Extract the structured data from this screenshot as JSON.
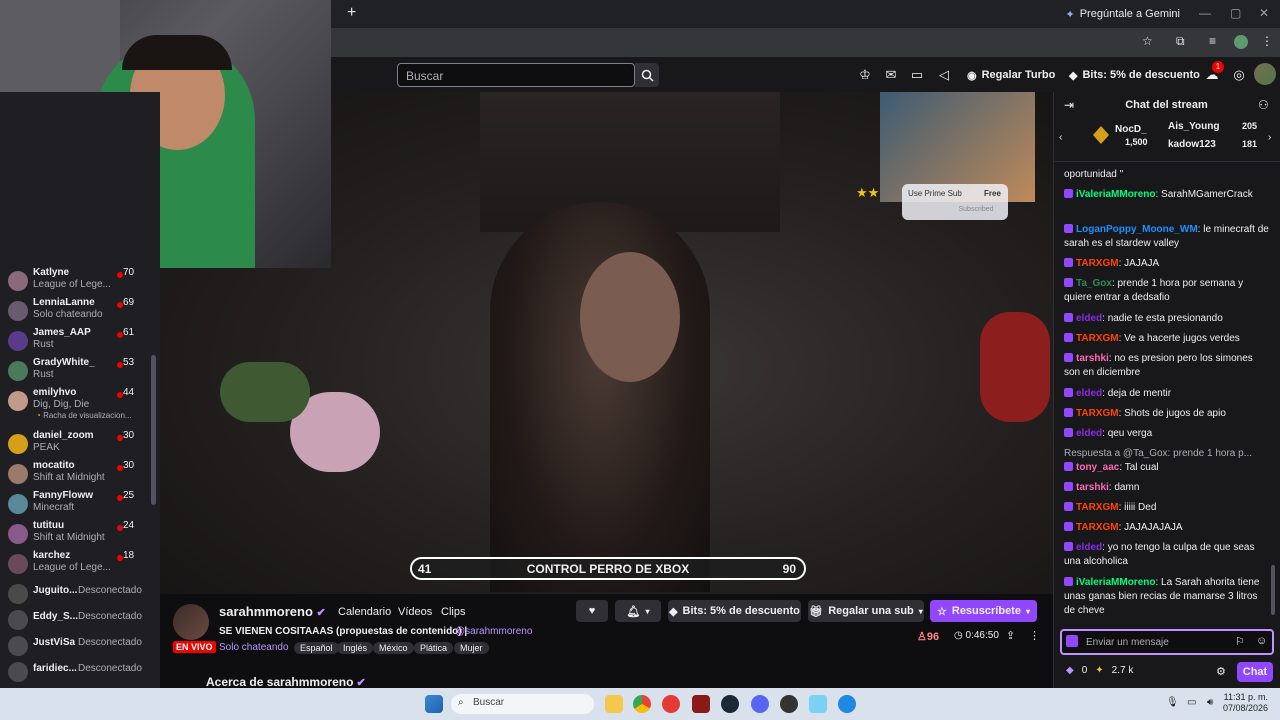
{
  "browser": {
    "gemini_label": "Pregúntale a Gemini",
    "new_tab": "+"
  },
  "topnav": {
    "search_placeholder": "Buscar",
    "turbo_label": "Regalar Turbo",
    "bits_label": "Bits: 5% de descuento",
    "notification_count": "1"
  },
  "sidebar": {
    "live": [
      {
        "name": "Katlyne",
        "game": "League of Lege...",
        "viewers": "70"
      },
      {
        "name": "LenniaLanne",
        "game": "Solo chateando",
        "viewers": "69"
      },
      {
        "name": "James_AAP",
        "game": "Rust",
        "viewers": "61"
      },
      {
        "name": "GradyWhite_",
        "game": "Rust",
        "viewers": "53"
      },
      {
        "name": "emilyhvo",
        "game": "Dig, Dig, Die",
        "viewers": "44",
        "extra": "Racha de visualizacion..."
      },
      {
        "name": "daniel_zoom",
        "game": "PEAK",
        "viewers": "30"
      },
      {
        "name": "mocatito",
        "game": "Shift at Midnight",
        "viewers": "30"
      },
      {
        "name": "FannyFloww",
        "game": "Minecraft",
        "viewers": "25"
      },
      {
        "name": "tutituu",
        "game": "Shift at Midnight",
        "viewers": "24"
      },
      {
        "name": "karchez",
        "game": "League of Lege...",
        "viewers": "18"
      }
    ],
    "offline": [
      {
        "name": "Juguito...",
        "status": "Desconectado"
      },
      {
        "name": "Eddy_S...",
        "status": "Desconectado"
      },
      {
        "name": "JustViSa",
        "status": "Desconectado"
      },
      {
        "name": "faridiec...",
        "status": "Desconectado"
      }
    ]
  },
  "video": {
    "goal_start": "41",
    "goal_label": "CONTROL PERRO DE XBOX",
    "goal_end": "90",
    "goal_progress": 0.0,
    "prime_text": "Use Prime Sub",
    "prime_free": "Free",
    "prime_btn": "Subscribed"
  },
  "info": {
    "streamer": "sarahmmoreno",
    "live_badge": "EN VIVO",
    "link_calendar": "Calendario",
    "link_videos": "Vídeos",
    "link_clips": "Clips",
    "title": "SE VIENEN COSITAAAS (propuestas de contenido) |",
    "handle": "@sarahmmoreno",
    "category": "Solo chateando",
    "tags": [
      "Español",
      "Inglés",
      "México",
      "Plática",
      "Mujer"
    ],
    "bits_btn": "Bits: 5% de descuento",
    "gift_btn": "Regalar una sub",
    "resub_btn": "Resuscríbete",
    "viewers": "96",
    "uptime": "0:46:50",
    "about": "Acerca de sarahmmoreno"
  },
  "chat": {
    "header": "Chat del stream",
    "hype": [
      {
        "name": "NocD_",
        "amount": "1,500"
      },
      {
        "name": "Ais_Young",
        "amount": "205"
      },
      {
        "name": "kadow123",
        "amount": "181"
      }
    ],
    "messages": [
      {
        "user": "",
        "text": "oportunidad \"",
        "color": "#efeff1"
      },
      {
        "user": "iValeriaMMoreno",
        "text": "SarahMGamerCrack",
        "color": "#00ff7f"
      },
      {
        "user": "LoganPoppy_Moone_WM",
        "text": "le minecraft de sarah es el stardew valley",
        "color": "#1e90ff"
      },
      {
        "user": "TARXGM",
        "text": "JAJAJA",
        "color": "#ff4500"
      },
      {
        "user": "Ta_Gox",
        "text": "prende 1 hora por semana y quiere entrar a dedsafio",
        "color": "#2e8b57"
      },
      {
        "user": "elded",
        "text": "nadie te esta presionando",
        "color": "#8a2be2"
      },
      {
        "user": "TARXGM",
        "text": "Ve a hacerte jugos verdes",
        "color": "#ff4500"
      },
      {
        "user": "tarshki",
        "text": "no es presion pero los simones son en diciembre",
        "color": "#ff69b4"
      },
      {
        "user": "elded",
        "text": "deja de mentir",
        "color": "#8a2be2"
      },
      {
        "user": "TARXGM",
        "text": "Shots de jugos de apio",
        "color": "#ff4500"
      },
      {
        "user": "elded",
        "text": "qeu verga",
        "color": "#8a2be2"
      },
      {
        "user": "",
        "text": "Respuesta a @Ta_Gox: prende 1 hora p...",
        "color": "#adadb8"
      },
      {
        "user": "tony_aac",
        "text": "Tal cual",
        "color": "#ff69b4"
      },
      {
        "user": "tarshki",
        "text": "damn",
        "color": "#ff69b4"
      },
      {
        "user": "TARXGM",
        "text": "iiiii Ded",
        "color": "#ff4500"
      },
      {
        "user": "TARXGM",
        "text": "JAJAJAJAJA",
        "color": "#ff4500"
      },
      {
        "user": "elded",
        "text": "yo no tengo la culpa de que seas una alcoholica",
        "color": "#8a2be2"
      },
      {
        "user": "iValeriaMMoreno",
        "text": "La Sarah ahorita tiene unas ganas bien recias de mamarse 3 litros de cheve",
        "color": "#00ff7f"
      }
    ],
    "input_placeholder": "Enviar un mensaje",
    "points": "0",
    "bits": "2.7 k",
    "chat_btn": "Chat"
  },
  "taskbar": {
    "search": "Buscar",
    "time": "11:31 p. m.",
    "date": "07/08/2026"
  },
  "colors": {
    "accent": "#9147ff",
    "live": "#eb0400",
    "link": "#bf94ff"
  }
}
